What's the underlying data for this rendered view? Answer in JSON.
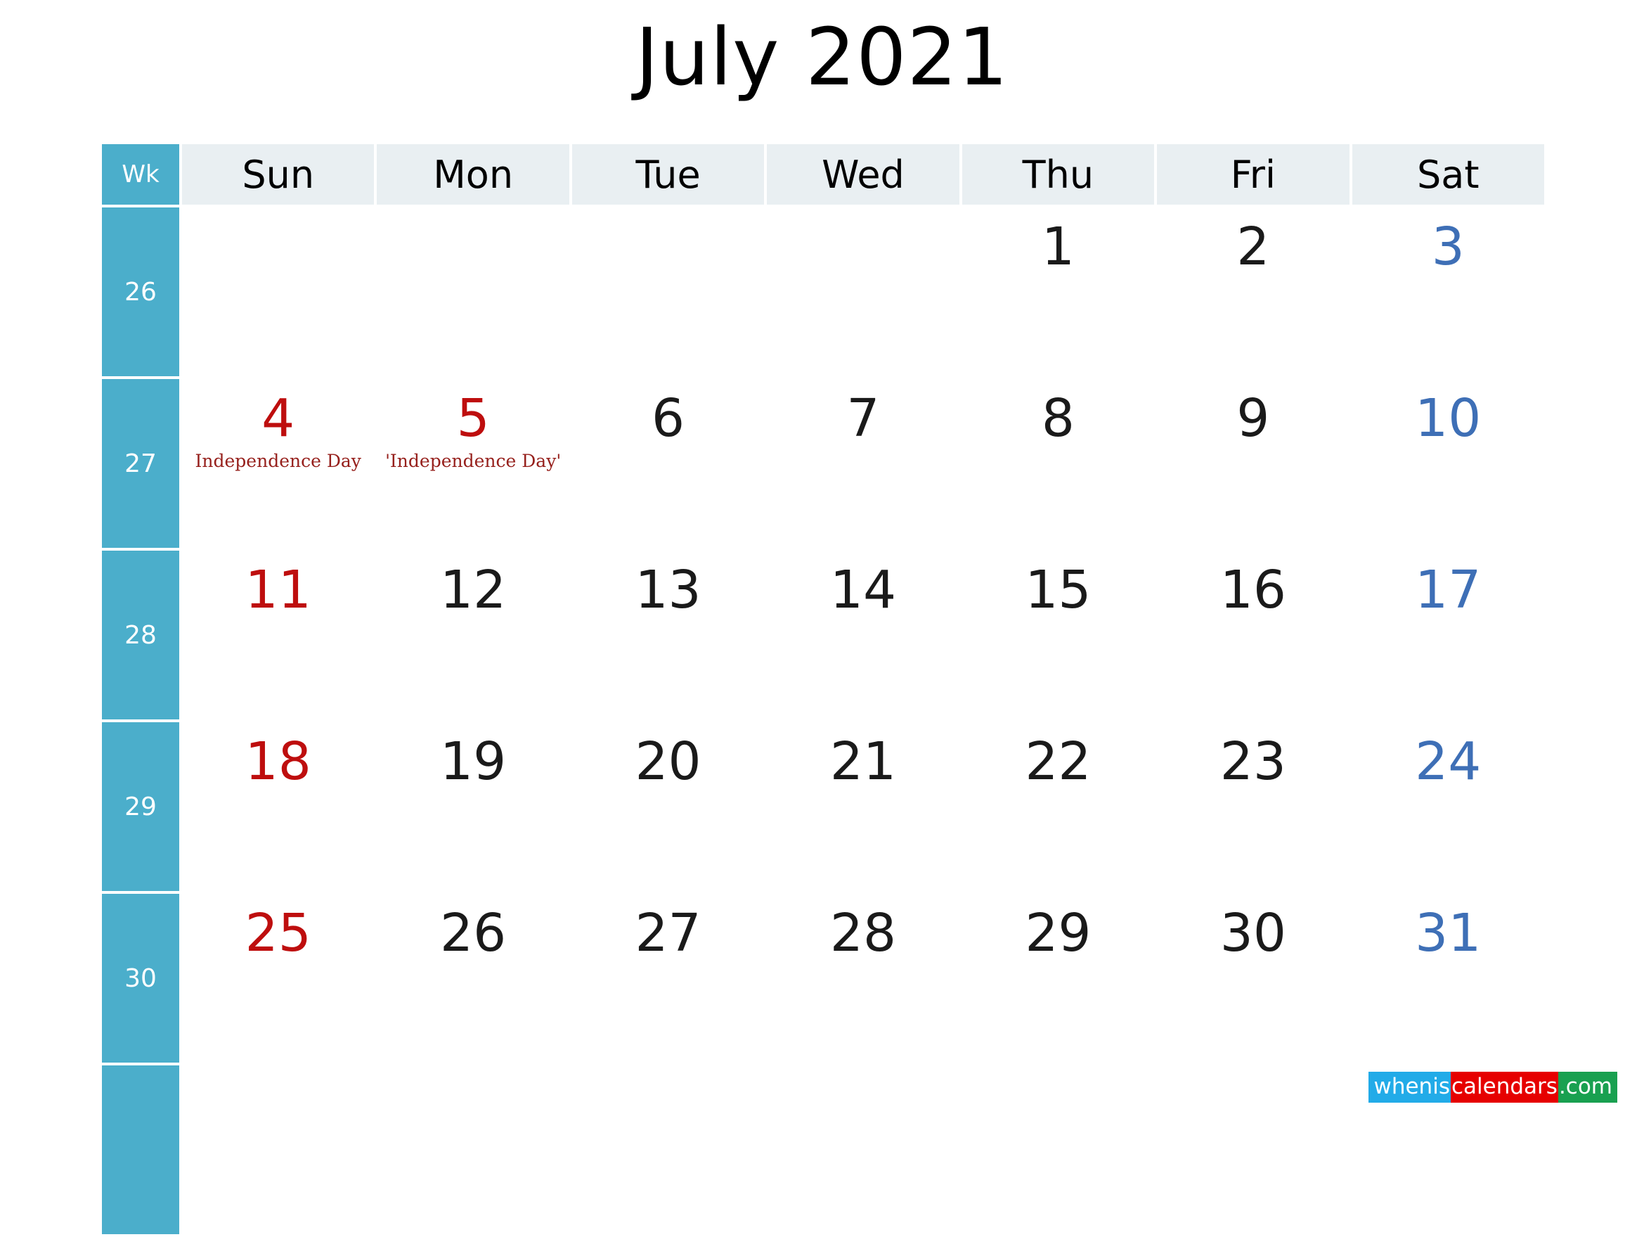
{
  "title": "July 2021",
  "theme": {
    "accent_teal": "#4BAECB",
    "header_bg": "#E9EFF2",
    "sunday_red": "#BE0E0E",
    "saturday_blue": "#3E6FB6",
    "event_red": "#96201C",
    "weekday_black": "#1a1a1a"
  },
  "header": {
    "week_label": "Wk",
    "days": [
      "Sun",
      "Mon",
      "Tue",
      "Wed",
      "Thu",
      "Fri",
      "Sat"
    ]
  },
  "weeks": [
    {
      "wk": "26",
      "days": [
        {
          "num": "",
          "event": ""
        },
        {
          "num": "",
          "event": ""
        },
        {
          "num": "",
          "event": ""
        },
        {
          "num": "",
          "event": ""
        },
        {
          "num": "1",
          "event": ""
        },
        {
          "num": "2",
          "event": ""
        },
        {
          "num": "3",
          "event": ""
        }
      ]
    },
    {
      "wk": "27",
      "days": [
        {
          "num": "4",
          "event": "Independence Day"
        },
        {
          "num": "5",
          "event": "'Independence Day'"
        },
        {
          "num": "6",
          "event": ""
        },
        {
          "num": "7",
          "event": ""
        },
        {
          "num": "8",
          "event": ""
        },
        {
          "num": "9",
          "event": ""
        },
        {
          "num": "10",
          "event": ""
        }
      ]
    },
    {
      "wk": "28",
      "days": [
        {
          "num": "11",
          "event": ""
        },
        {
          "num": "12",
          "event": ""
        },
        {
          "num": "13",
          "event": ""
        },
        {
          "num": "14",
          "event": ""
        },
        {
          "num": "15",
          "event": ""
        },
        {
          "num": "16",
          "event": ""
        },
        {
          "num": "17",
          "event": ""
        }
      ]
    },
    {
      "wk": "29",
      "days": [
        {
          "num": "18",
          "event": ""
        },
        {
          "num": "19",
          "event": ""
        },
        {
          "num": "20",
          "event": ""
        },
        {
          "num": "21",
          "event": ""
        },
        {
          "num": "22",
          "event": ""
        },
        {
          "num": "23",
          "event": ""
        },
        {
          "num": "24",
          "event": ""
        }
      ]
    },
    {
      "wk": "30",
      "days": [
        {
          "num": "25",
          "event": ""
        },
        {
          "num": "26",
          "event": ""
        },
        {
          "num": "27",
          "event": ""
        },
        {
          "num": "28",
          "event": ""
        },
        {
          "num": "29",
          "event": ""
        },
        {
          "num": "30",
          "event": ""
        },
        {
          "num": "31",
          "event": ""
        }
      ]
    },
    {
      "wk": "",
      "days": [
        {
          "num": "",
          "event": ""
        },
        {
          "num": "",
          "event": ""
        },
        {
          "num": "",
          "event": ""
        },
        {
          "num": "",
          "event": ""
        },
        {
          "num": "",
          "event": ""
        },
        {
          "num": "",
          "event": ""
        },
        {
          "num": "",
          "event": ""
        }
      ]
    }
  ],
  "watermark": {
    "part1": "whenis",
    "part2": "calendars",
    "part3": ".com"
  }
}
